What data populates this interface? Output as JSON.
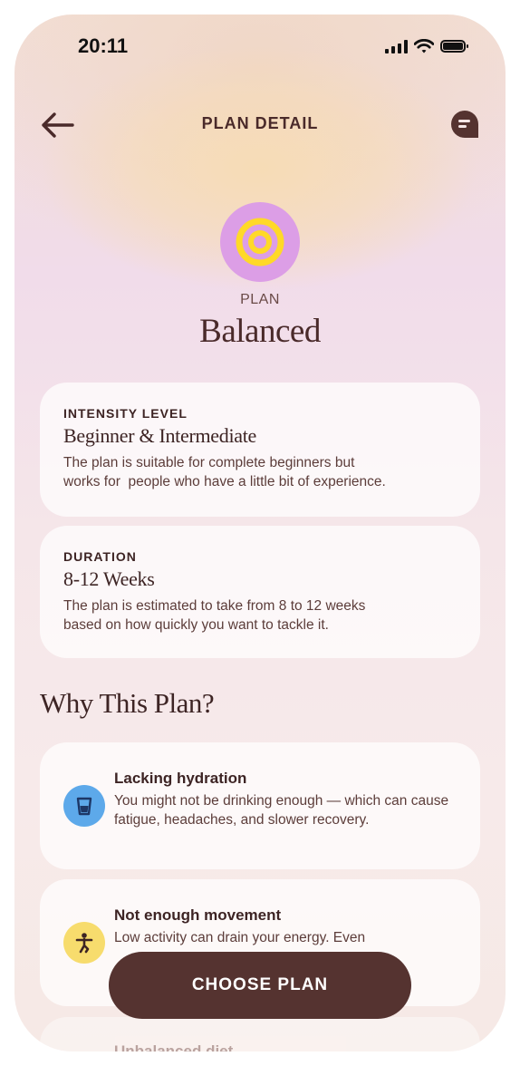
{
  "status_bar": {
    "time": "20:11"
  },
  "header": {
    "title": "PLAN DETAIL"
  },
  "plan": {
    "label": "PLAN",
    "name": "Balanced",
    "icon": "target-icon",
    "icon_colors": {
      "circle": "#dc9ee6",
      "rings": "#ffd928"
    }
  },
  "intensity": {
    "eyebrow": "INTENSITY LEVEL",
    "heading": "Beginner & Intermediate",
    "description": "The plan is suitable for complete beginners but\nworks for  people who have a little bit of experience."
  },
  "duration": {
    "eyebrow": "DURATION",
    "heading": "8-12 Weeks",
    "description": "The plan is estimated to take from 8 to 12 weeks\nbased on how quickly you want to tackle it."
  },
  "why": {
    "title": "Why This Plan?",
    "reasons": [
      {
        "title": "Lacking hydration",
        "text": "You might not be drinking enough — which can cause fatigue, headaches, and slower recovery.",
        "icon": "water-glass-icon",
        "icon_bg": "#5da9ea"
      },
      {
        "title": "Not enough movement",
        "text": "Low activity can drain your energy. Even",
        "icon": "stretching-person-icon",
        "icon_bg": "#f7dc6d"
      },
      {
        "title": "Unbalanced diet",
        "text": "",
        "icon": "",
        "icon_bg": ""
      }
    ]
  },
  "cta": {
    "label": "CHOOSE PLAN"
  },
  "colors": {
    "primary_dark": "#553330",
    "text": "#4a2a2a"
  }
}
